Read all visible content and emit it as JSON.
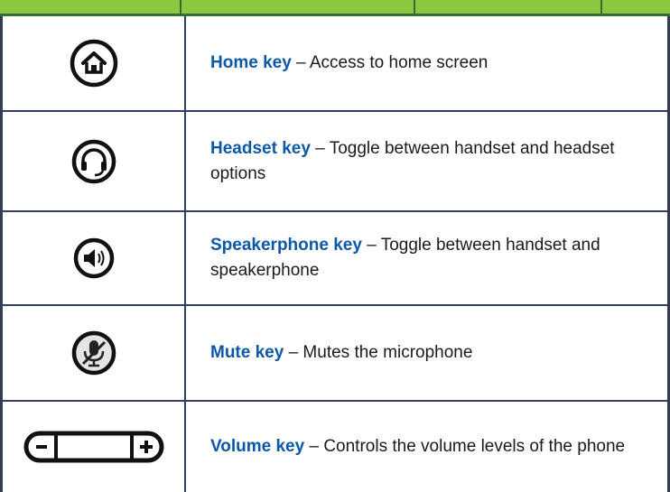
{
  "keys": [
    {
      "name": "Home key",
      "description": " – Access to home screen",
      "icon": "home-icon"
    },
    {
      "name": "Headset key",
      "description": " – Toggle between handset and headset options",
      "icon": "headset-icon"
    },
    {
      "name": "Speakerphone key",
      "description": " – Toggle between handset and speakerphone",
      "icon": "speaker-icon"
    },
    {
      "name": "Mute key",
      "description": " – Mutes the microphone",
      "icon": "mute-icon"
    },
    {
      "name": "Volume key",
      "description": " – Controls the volume levels of the phone",
      "icon": "volume-icon"
    }
  ],
  "colors": {
    "header_green": "#8dc63f",
    "header_dark": "#2d6f35",
    "key_name_blue": "#0b58a9",
    "grid": "#2e3e64"
  }
}
